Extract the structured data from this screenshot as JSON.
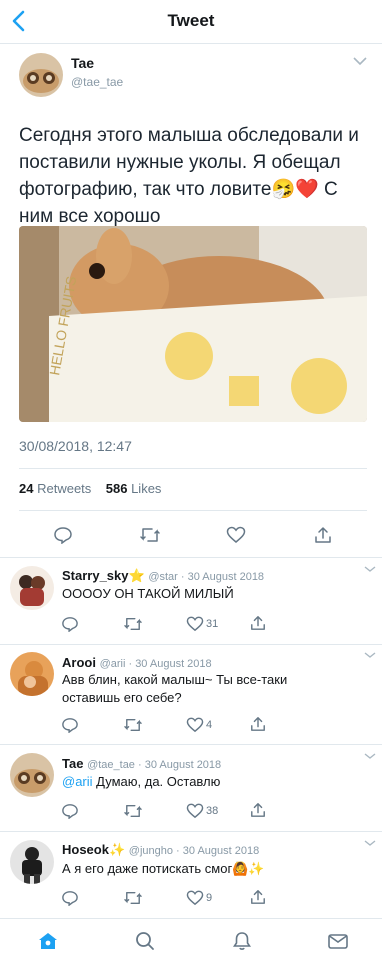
{
  "header": {
    "title": "Tweet",
    "back_icon": "chevron-left-icon"
  },
  "main_tweet": {
    "name": "Tae",
    "handle": "@tae_tae",
    "text": "Сегодня этого малыша обследовали и поставили нужные уколы. Я обещал фотографию, так что ловите🤧❤️ С ним все хорошо",
    "photo_alt": "rabbit in a basket",
    "timestamp": "30/08/2018, 12:47",
    "retweets_count": "24",
    "retweets_label": "Retweets",
    "likes_count": "586",
    "likes_label": "Likes"
  },
  "replies": [
    {
      "name": "Starry_sky⭐",
      "meta": "@star · 30 August 2018",
      "text": "ОООOУ ОН ТАКОЙ МИЛЫЙ",
      "likes": "31"
    },
    {
      "name": "Arooi",
      "meta": "@arii · 30 August 2018",
      "text": "Авв блин, какой малыш~ Ты все-таки оставишь его себе?",
      "likes": "4"
    },
    {
      "name": "Tae",
      "meta": "@tae_tae · 30 August 2018",
      "mention": "@arii",
      "text": " Думаю, да. Оставлю",
      "likes": "38"
    },
    {
      "name": "Hoseok✨",
      "meta": "@jungho · 30 August 2018",
      "text": "А я его даже потискать смог🙆✨",
      "likes": "9"
    }
  ],
  "tabbar": [
    "home-icon",
    "search-icon",
    "bell-icon",
    "mail-icon"
  ],
  "colors": {
    "accent": "#1da1f2",
    "text": "#14171a",
    "muted": "#657786",
    "divider": "#e1e8ed"
  }
}
